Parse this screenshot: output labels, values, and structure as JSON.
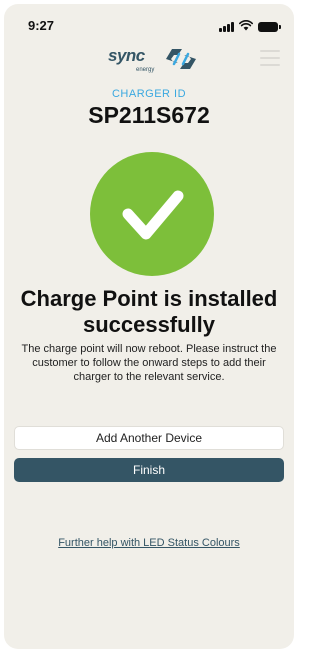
{
  "status_bar": {
    "time": "9:27",
    "icons": [
      "signal-icon",
      "wifi-icon",
      "battery-icon"
    ]
  },
  "logo": {
    "brand": "sync",
    "sub": "energy",
    "icon": "sync-logo-icon"
  },
  "menu": {
    "icon": "hamburger-menu-icon"
  },
  "charger": {
    "id_label": "CHARGER ID",
    "id_value": "SP211S672"
  },
  "success": {
    "icon": "checkmark-icon",
    "color": "#7dbf3a",
    "headline": "Charge Point is installed successfully",
    "message": "The charge point will now reboot. Please instruct the customer to follow the onward steps to add their charger to the relevant service."
  },
  "actions": {
    "add_device_label": "Add Another Device",
    "finish_label": "Finish"
  },
  "help": {
    "link_text": "Further help with LED Status Colours"
  },
  "colors": {
    "accent": "#3aa8e0",
    "primary": "#345565",
    "success": "#7dbf3a",
    "background": "#f1efe9"
  }
}
